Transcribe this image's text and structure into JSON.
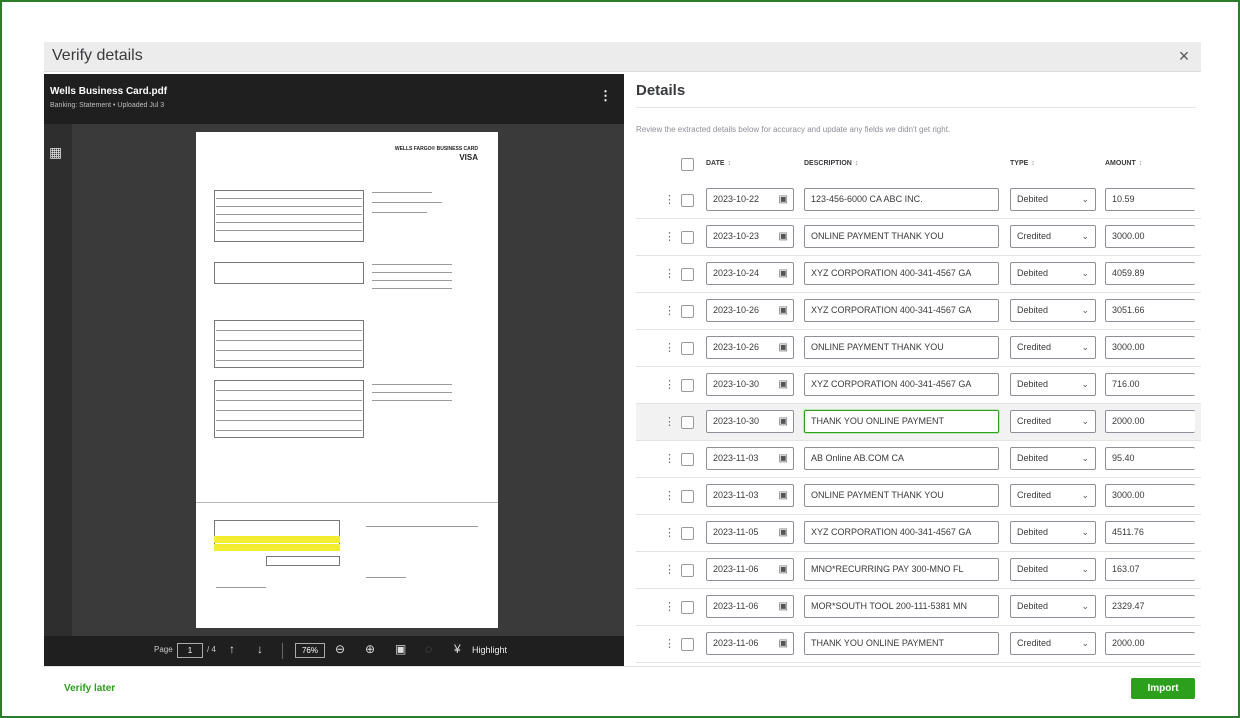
{
  "modal": {
    "title": "Verify details",
    "close_icon": "×"
  },
  "viewer": {
    "file_name": "Wells Business Card.pdf",
    "file_meta": "Banking: Statement • Uploaded Jul 3",
    "menu_icon": "⋮",
    "thumbs_icon": "▦",
    "page_brand": "WELLS FARGO® BUSINESS CARD",
    "page_visa": "VISA",
    "footer": {
      "page_label": "Page",
      "page_value": "1",
      "page_total": "/ 4",
      "zoom": "76%",
      "highlight_label": "Highlight"
    }
  },
  "details": {
    "title": "Details",
    "description": "Review the extracted details below for accuracy and update any fields we didn't get right.",
    "columns": {
      "date": "DATE",
      "description": "DESCRIPTION",
      "type": "TYPE",
      "amount": "AMOUNT"
    },
    "rows": [
      {
        "date": "2023-10-22",
        "description": "123-456-6000 CA ABC INC.",
        "type": "Debited",
        "amount": "10.59"
      },
      {
        "date": "2023-10-23",
        "description": "ONLINE PAYMENT THANK YOU",
        "type": "Credited",
        "amount": "3000.00"
      },
      {
        "date": "2023-10-24",
        "description": "XYZ CORPORATION 400-341-4567 GA",
        "type": "Debited",
        "amount": "4059.89"
      },
      {
        "date": "2023-10-26",
        "description": "XYZ CORPORATION 400-341-4567 GA",
        "type": "Debited",
        "amount": "3051.66"
      },
      {
        "date": "2023-10-26",
        "description": "ONLINE PAYMENT THANK YOU",
        "type": "Credited",
        "amount": "3000.00"
      },
      {
        "date": "2023-10-30",
        "description": "XYZ CORPORATION 400-341-4567 GA",
        "type": "Debited",
        "amount": "716.00"
      },
      {
        "date": "2023-10-30",
        "description": "THANK YOU ONLINE PAYMENT",
        "type": "Credited",
        "amount": "2000.00"
      },
      {
        "date": "2023-11-03",
        "description": "AB Online AB.COM CA",
        "type": "Debited",
        "amount": "95.40"
      },
      {
        "date": "2023-11-03",
        "description": "ONLINE PAYMENT THANK YOU",
        "type": "Credited",
        "amount": "3000.00"
      },
      {
        "date": "2023-11-05",
        "description": "XYZ CORPORATION 400-341-4567 GA",
        "type": "Debited",
        "amount": "4511.76"
      },
      {
        "date": "2023-11-06",
        "description": "MNO*RECURRING PAY 300-MNO FL",
        "type": "Debited",
        "amount": "163.07"
      },
      {
        "date": "2023-11-06",
        "description": "MOR*SOUTH TOOL 200-111-5381 MN",
        "type": "Debited",
        "amount": "2329.47"
      },
      {
        "date": "2023-11-06",
        "description": "THANK YOU ONLINE PAYMENT",
        "type": "Credited",
        "amount": "2000.00"
      }
    ]
  },
  "footer": {
    "verify_later": "Verify later",
    "import": "Import"
  }
}
